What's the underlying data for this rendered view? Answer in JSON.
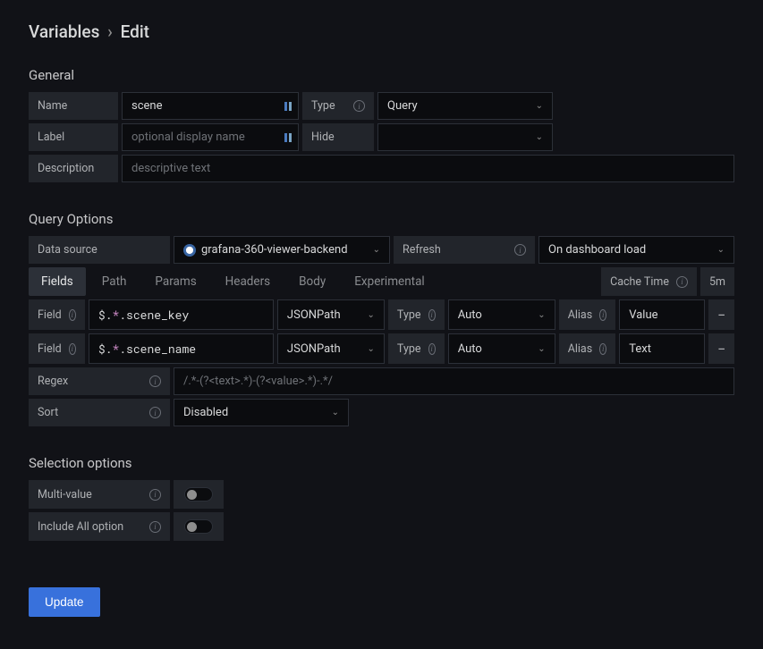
{
  "breadcrumb": {
    "root": "Variables",
    "leaf": "Edit"
  },
  "sections": {
    "general": "General",
    "query": "Query Options",
    "selection": "Selection options"
  },
  "labels": {
    "name": "Name",
    "type": "Type",
    "label": "Label",
    "hide": "Hide",
    "description": "Description",
    "datasource": "Data source",
    "refresh": "Refresh",
    "cache_time": "Cache Time",
    "field": "Field",
    "type2": "Type",
    "alias": "Alias",
    "regex": "Regex",
    "sort": "Sort",
    "multi": "Multi-value",
    "include_all": "Include All option"
  },
  "values": {
    "name": "scene",
    "type": "Query",
    "hide": "",
    "refresh": "On dashboard load",
    "datasource": "grafana-360-viewer-backend",
    "cache_time": "5m",
    "sort": "Disabled",
    "update_btn": "Update"
  },
  "placeholders": {
    "label": "optional display name",
    "description": "descriptive text",
    "regex": "/.*-(?<text>.*)-(?<value>.*)-.*/"
  },
  "tabs": [
    "Fields",
    "Path",
    "Params",
    "Headers",
    "Body",
    "Experimental"
  ],
  "fields": [
    {
      "expr_prefix": "$.",
      "expr_suffix": ".scene_key",
      "lang": "JSONPath",
      "type": "Auto",
      "alias": "Value"
    },
    {
      "expr_prefix": "$.",
      "expr_suffix": ".scene_name",
      "lang": "JSONPath",
      "type": "Auto",
      "alias": "Text"
    }
  ]
}
